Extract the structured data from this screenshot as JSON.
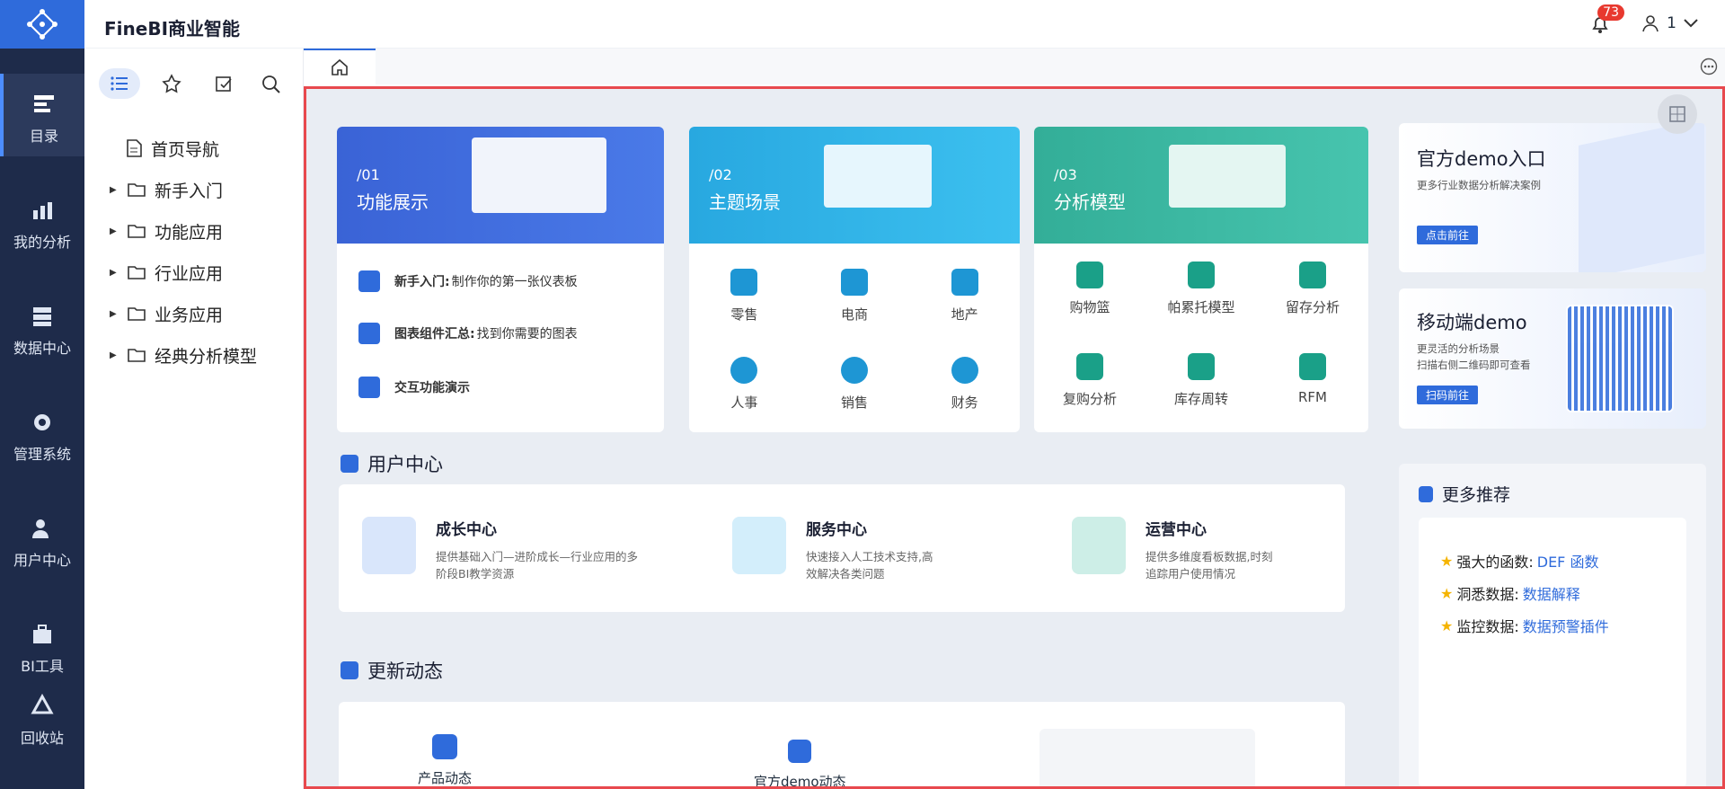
{
  "app": {
    "title": "FineBI商业智能",
    "notifications": "73",
    "user": "1"
  },
  "nav": [
    "目录",
    "我的分析",
    "数据中心",
    "管理系统",
    "用户中心",
    "BI工具",
    "回收站"
  ],
  "tree": [
    "首页导航",
    "新手入门",
    "功能应用",
    "行业应用",
    "业务应用",
    "经典分析模型"
  ],
  "cards": [
    {
      "num": "/01",
      "title": "功能展示",
      "color": "#3f6fdc",
      "rows": [
        {
          "b": "新手入门:",
          "t": "制作你的第一张仪表板"
        },
        {
          "b": "图表组件汇总:",
          "t": "找到你需要的图表"
        },
        {
          "b": "交互功能演示",
          "t": ""
        }
      ]
    },
    {
      "num": "/02",
      "title": "主题场景",
      "color": "#2fb3e4",
      "items": [
        "零售",
        "电商",
        "地产",
        "人事",
        "销售",
        "财务"
      ]
    },
    {
      "num": "/03",
      "title": "分析模型",
      "color": "#39b8a3",
      "items": [
        "购物篮",
        "帕累托模型",
        "留存分析",
        "复购分析",
        "库存周转",
        "RFM"
      ]
    }
  ],
  "user_center": {
    "title": "用户中心",
    "items": [
      {
        "title": "成长中心",
        "desc": "提供基础入门—进阶成长—行业应用的多阶段BI教学资源"
      },
      {
        "title": "服务中心",
        "desc": "快速接入人工技术支持,高效解决各类问题"
      },
      {
        "title": "运营中心",
        "desc": "提供多维度看板数据,时刻追踪用户使用情况"
      }
    ]
  },
  "updates": {
    "title": "更新动态",
    "items": [
      "产品动态",
      "官方demo动态"
    ]
  },
  "right": {
    "demo": {
      "title": "官方demo入口",
      "sub": "更多行业数据分析解决案例",
      "btn": "点击前往"
    },
    "mobile": {
      "title": "移动端demo",
      "sub1": "更灵活的分析场景",
      "sub2": "扫描右侧二维码即可查看",
      "btn": "扫码前往"
    },
    "recs": {
      "title": "更多推荐",
      "items": [
        {
          "k": "强大的函数:",
          "v": "DEF 函数"
        },
        {
          "k": "洞悉数据:",
          "v": "数据解释"
        },
        {
          "k": "监控数据:",
          "v": "数据预警插件"
        }
      ]
    }
  }
}
